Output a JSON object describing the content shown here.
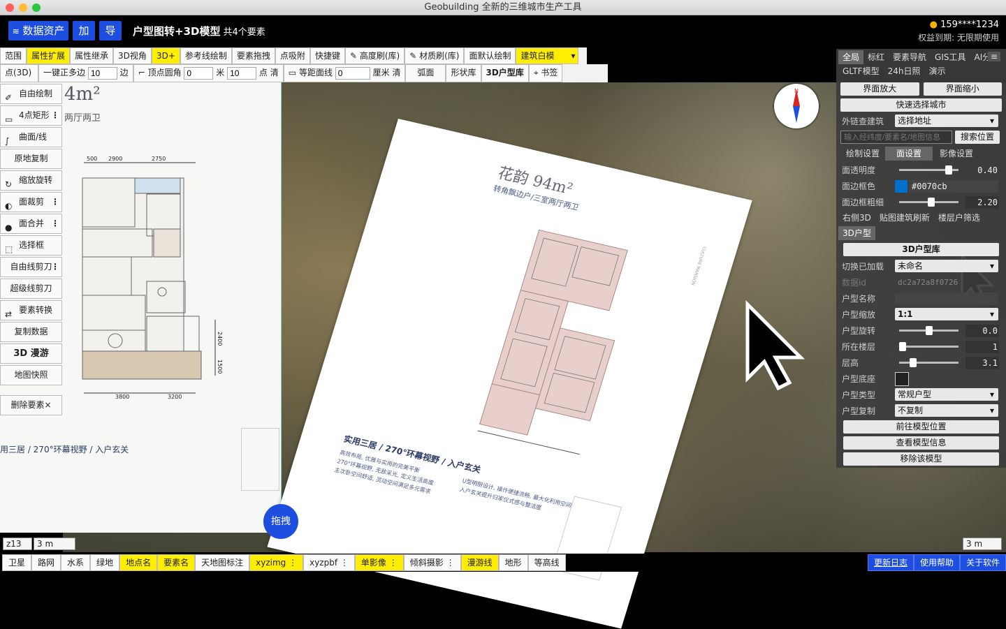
{
  "window": {
    "title": "Geobuilding 全新的三维城市生产工具"
  },
  "appbar": {
    "data_assets": "数据资产",
    "add": "加",
    "import": "导",
    "title": "户型图转+3D模型",
    "count": "共4个要素",
    "user": "159****1234",
    "expiry": "权益到期: 无限期使用"
  },
  "toolbar1": [
    "范围",
    "属性扩展",
    "属性继承",
    "3D视角",
    "3D+",
    "参考线绘制",
    "要素拖拽",
    "点吸附",
    "快捷键",
    "高度刷(库)",
    "材质刷(库)",
    "面默认绘制",
    "建筑白模"
  ],
  "toolbar2": {
    "point": "点(3D)",
    "one_key": "一键正多边",
    "sides": "10",
    "sides_unit": "边",
    "vertex_round": "顶点圆角",
    "round_val": "0",
    "round_unit": "米",
    "pts": "10",
    "pts_unit": "点",
    "clear1": "清",
    "equidistant": "等距面线",
    "eq_val": "0",
    "eq_unit": "厘米",
    "clear2": "清",
    "arc": "弧面",
    "shape_lib": "形状库",
    "lib3d": "3D户型库",
    "bookmark": "书签"
  },
  "sidebar": [
    "自由绘制",
    "4点矩形",
    "曲面/线",
    "原地复制",
    "缩放旋转",
    "面裁剪",
    "面合并",
    "选择框",
    "自由线剪刀",
    "超级线剪刀",
    "要素转换",
    "复制数据",
    "3D 漫游",
    "地图快照",
    "删除要素×"
  ],
  "plan_left": {
    "area": "4m²",
    "rooms": "两厅两卫",
    "headline": "用三居 / 270°环幕视野 / 入户玄关",
    "d1": "2900",
    "d2": "2750",
    "d3": "3800",
    "d4": "3200",
    "d5": "500",
    "d6": "2400",
    "d7": "1500"
  },
  "paper": {
    "name": "花韵",
    "area": "94m²",
    "subtitle": "转角飘边户/三室两厅两卫",
    "headline": "实用三居 / 270°环幕视野 / 入户玄关",
    "bullets": [
      "高效布局, 优雅与实用的完美平衡",
      "270°环幕视野, 无敌采光, 定义生活高度",
      "主次卧空间舒适, 灵动空间满足多元需求",
      "U型明厨设计, 操作便捷流畅, 最大化利用空间",
      "入户玄关提升归家仪式感与整洁度"
    ],
    "brand": "CULTURE MANSION"
  },
  "panel": {
    "tabs1": [
      "全局",
      "标红",
      "要素导航",
      "GIS工具"
    ],
    "tabs2": [
      "AI分割",
      "GLTF模型",
      "24h日照",
      "演示"
    ],
    "zoom_in": "界面放大",
    "zoom_out": "界面缩小",
    "quick_city": "快速选择城市",
    "link_label": "外链查建筑",
    "link_sel": "选择地址",
    "search_placeholder": "输入经纬度/要素名/地图信息",
    "search_btn": "搜索位置",
    "tabs3": [
      "绘制设置",
      "面设置",
      "影像设置"
    ],
    "opacity_label": "面透明度",
    "opacity": "0.40",
    "opacity_frac": 0.88,
    "border_color_label": "面边框色",
    "border_color": "#0070cb",
    "border_width_label": "面边框粗细",
    "border_width": "2.20",
    "border_width_frac": 0.55,
    "tabs4": [
      "右侧3D",
      "贴图建筑刷新",
      "楼层户筛选"
    ],
    "section": "3D户型",
    "lib_btn": "3D户型库",
    "switch_label": "切换已加载",
    "switch_val": "未命名",
    "id_label": "数据id",
    "id_val": "dc2a72a8f0726",
    "name_label": "户型名称",
    "scale_label": "户型缩放",
    "scale_val": "1:1",
    "rotate_label": "户型旋转",
    "rotate_val": "0.0",
    "rotate_frac": 0.5,
    "floor_label": "所在楼层",
    "floor_val": "1",
    "floor_frac": 0.0,
    "height_label": "层高",
    "height_val": "3.1",
    "height_frac": 0.2,
    "base_label": "户型底座",
    "type_label": "户型类型",
    "type_val": "常规户型",
    "copy_label": "户型复制",
    "copy_val": "不复制",
    "goto": "前往模型位置",
    "info": "查看模型信息",
    "remove": "移除该模型"
  },
  "scale": {
    "zoom": "z13",
    "left": "3 m",
    "right": "3 m"
  },
  "drag": "拖拽",
  "bottombar": [
    "卫星",
    "路网",
    "水系",
    "绿地",
    "地点名",
    "要素名",
    "天地图标注",
    "xyzimg",
    "xyzpbf",
    "单影像",
    "倾斜摄影",
    "漫游线",
    "地形",
    "等高线"
  ],
  "bottom_right": [
    "更新日志",
    "使用帮助",
    "关于软件"
  ],
  "colors": {
    "accent": "#1d4ee0",
    "highlight": "#ffee00",
    "panel_bg": "#3c3c3c"
  }
}
